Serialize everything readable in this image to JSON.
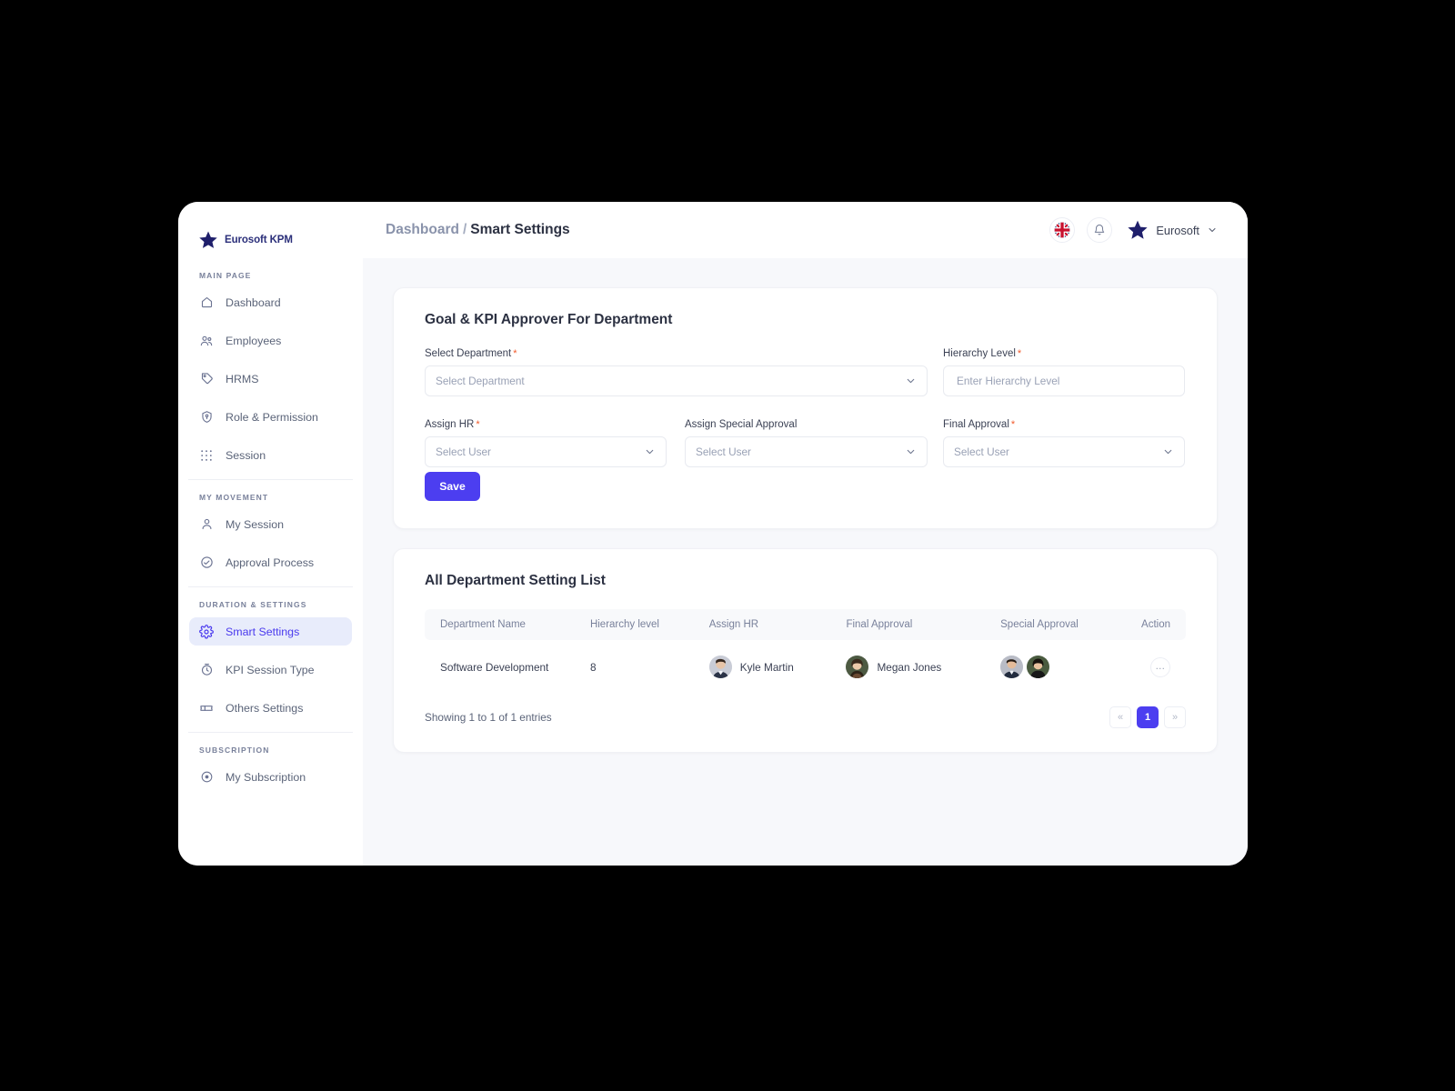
{
  "brand": {
    "name": "Eurosoft KPM"
  },
  "topbar": {
    "breadcrumb_parent": "Dashboard",
    "breadcrumb_separator": "/",
    "breadcrumb_current": "Smart Settings",
    "language_icon": "uk-flag-icon",
    "notification_icon": "bell-icon",
    "user_name": "Eurosoft",
    "user_chevron": "chevron-down-icon"
  },
  "sidebar": {
    "sections": [
      {
        "label": "MAIN PAGE",
        "items": [
          {
            "label": "Dashboard",
            "icon": "home-icon",
            "active": false
          },
          {
            "label": "Employees",
            "icon": "users-icon",
            "active": false
          },
          {
            "label": "HRMS",
            "icon": "tag-icon",
            "active": false
          },
          {
            "label": "Role & Permission",
            "icon": "shield-pin-icon",
            "active": false
          },
          {
            "label": "Session",
            "icon": "grid-dots-icon",
            "active": false
          }
        ]
      },
      {
        "label": "MY MOVEMENT",
        "items": [
          {
            "label": "My Session",
            "icon": "user-icon",
            "active": false
          },
          {
            "label": "Approval Process",
            "icon": "activity-circle-icon",
            "active": false
          }
        ]
      },
      {
        "label": "DURATION & SETTINGS",
        "items": [
          {
            "label": "Smart Settings",
            "icon": "gear-icon",
            "active": true
          },
          {
            "label": "KPI Session Type",
            "icon": "clock-icon",
            "active": false
          },
          {
            "label": "Others Settings",
            "icon": "ticket-icon",
            "active": false
          }
        ]
      },
      {
        "label": "SUBSCRIPTION",
        "items": [
          {
            "label": "My Subscription",
            "icon": "circle-dot-icon",
            "active": false
          }
        ]
      }
    ]
  },
  "form_card": {
    "title": "Goal & KPI Approver For Department",
    "fields": {
      "select_department": {
        "label": "Select Department",
        "required": true,
        "placeholder": "Select Department",
        "value": ""
      },
      "hierarchy_level": {
        "label": "Hierarchy Level",
        "required": true,
        "placeholder": "Enter Hierarchy Level",
        "value": ""
      },
      "assign_hr": {
        "label": "Assign HR",
        "required": true,
        "placeholder": "Select User",
        "value": ""
      },
      "assign_special_approval": {
        "label": "Assign Special Approval",
        "required": false,
        "placeholder": "Select User",
        "value": ""
      },
      "final_approval": {
        "label": "Final Approval",
        "required": true,
        "placeholder": "Select User",
        "value": ""
      }
    },
    "save_label": "Save"
  },
  "table_card": {
    "title": "All Department Setting List",
    "columns": [
      "Department Name",
      "Hierarchy level",
      "Assign HR",
      "Final Approval",
      "Special Approval",
      "Action"
    ],
    "rows": [
      {
        "department_name": "Software Development",
        "hierarchy_level": "8",
        "assign_hr": "Kyle Martin",
        "final_approval": "Megan Jones",
        "special_approval_count": 2,
        "action": "…"
      }
    ],
    "showing_text": "Showing 1 to 1 of 1 entries",
    "pagination": {
      "prev": "«",
      "next": "»",
      "pages": [
        "1"
      ],
      "current": "1"
    }
  },
  "colors": {
    "accent": "#4c3ef0",
    "brand_navy": "#2b2f7a",
    "required_star": "#f1592a",
    "page_bg": "#f7f8fb",
    "active_nav_bg": "#e8ecfb"
  }
}
